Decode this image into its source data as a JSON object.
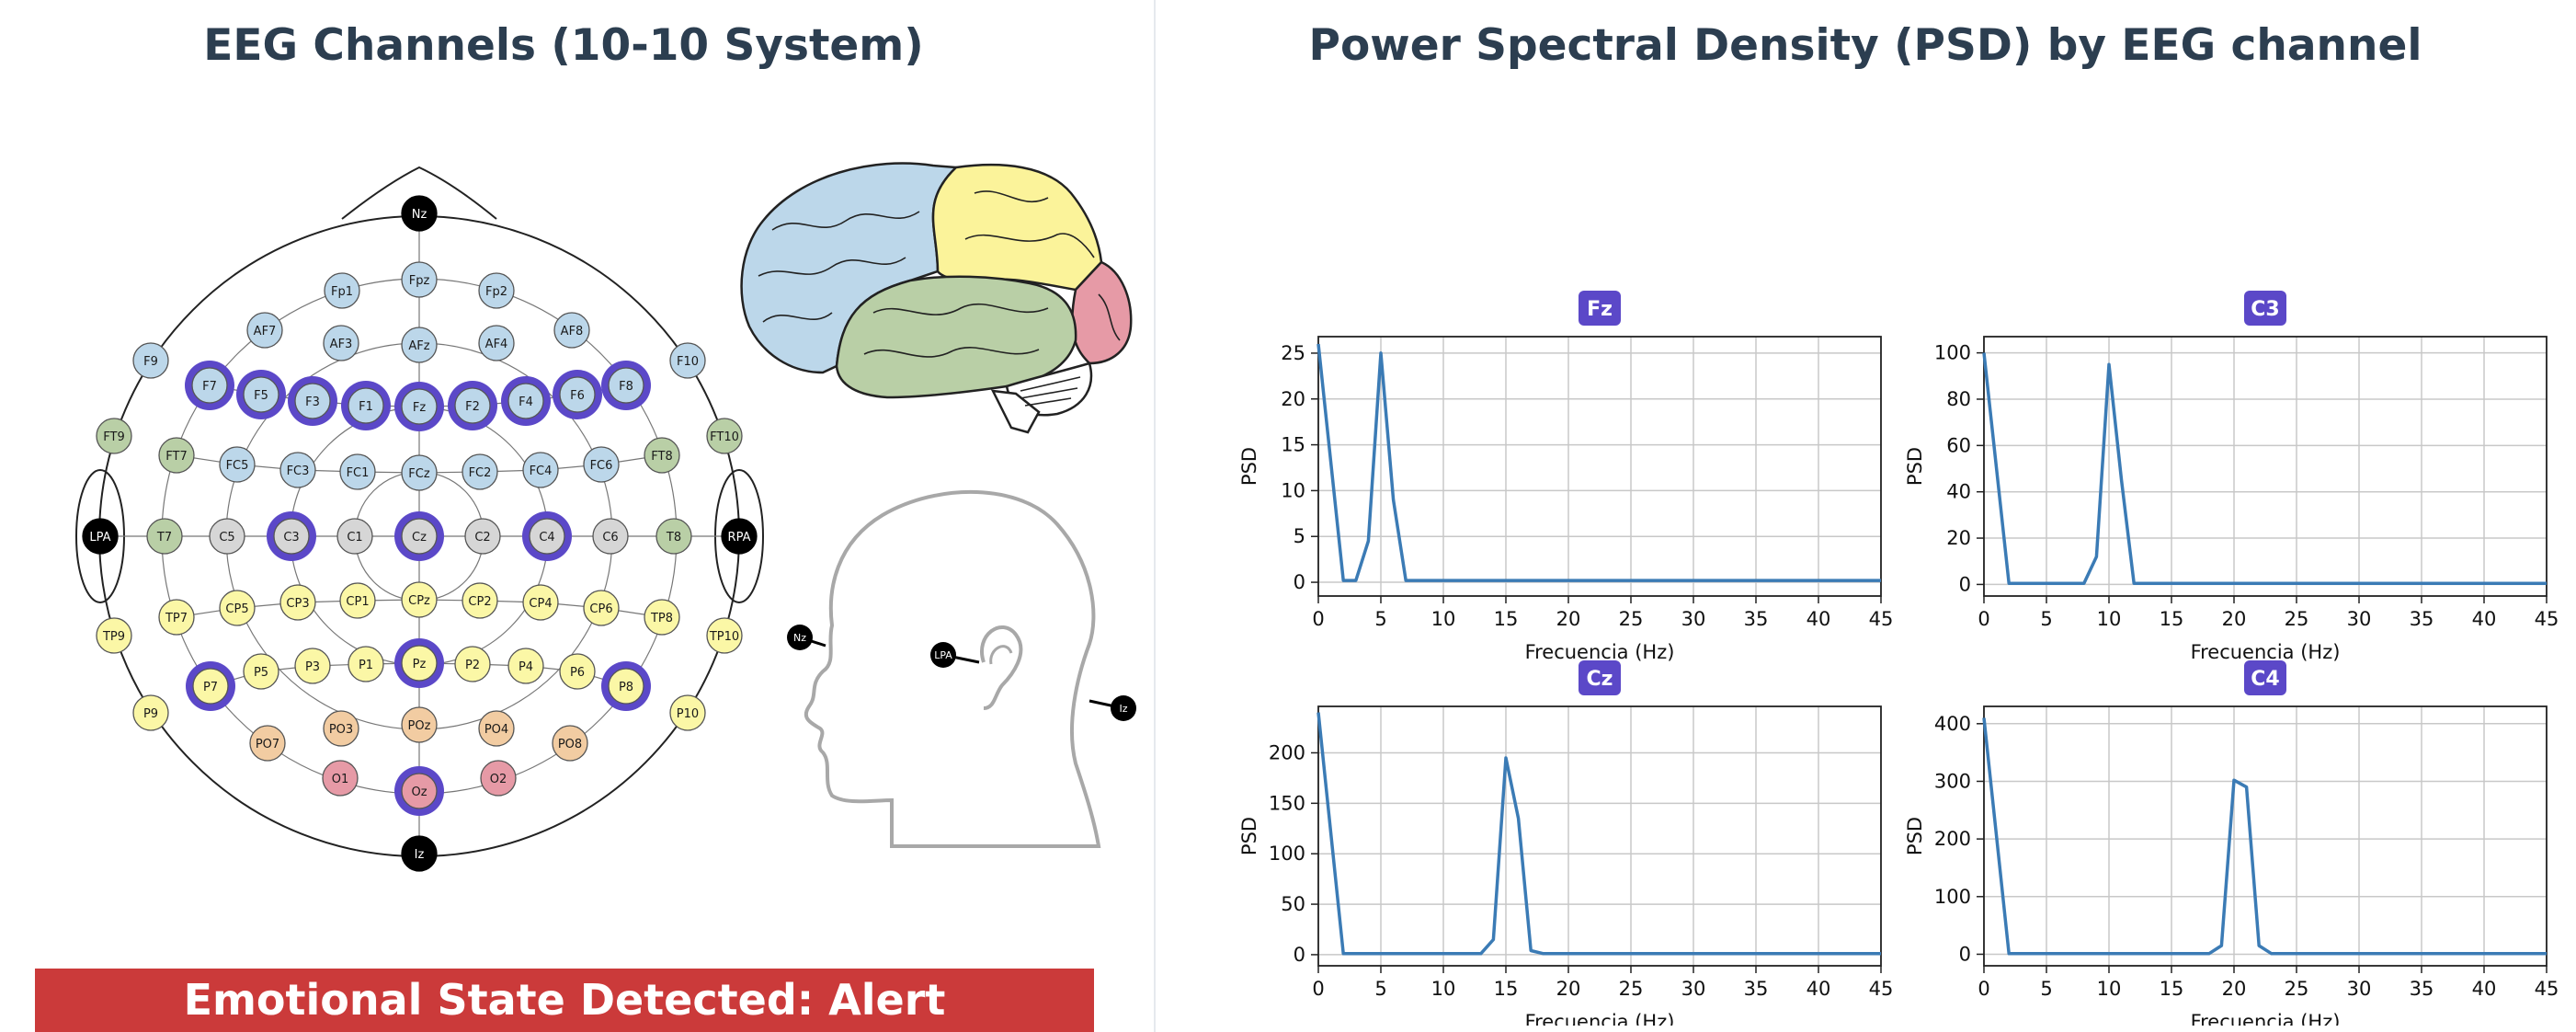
{
  "left_panel": {
    "title": "EEG Channels (10-10 System)",
    "highlight_color": "#5b48c8",
    "region_colors": {
      "frontal": "#bcd7ea",
      "central": "#d6d6d6",
      "parietal": "#fbf7a6",
      "temporal": "#b9cfa6",
      "occipital": "#e69aa6",
      "parieto-occipital": "#f2cca2",
      "fiducial": "#000000"
    },
    "electrodes": [
      {
        "label": "Nz",
        "region": "fiducial",
        "selected": false
      },
      {
        "label": "Fp1",
        "region": "frontal",
        "selected": false
      },
      {
        "label": "Fpz",
        "region": "frontal",
        "selected": false
      },
      {
        "label": "Fp2",
        "region": "frontal",
        "selected": false
      },
      {
        "label": "AF7",
        "region": "frontal",
        "selected": false
      },
      {
        "label": "AF3",
        "region": "frontal",
        "selected": false
      },
      {
        "label": "AFz",
        "region": "frontal",
        "selected": false
      },
      {
        "label": "AF4",
        "region": "frontal",
        "selected": false
      },
      {
        "label": "AF8",
        "region": "frontal",
        "selected": false
      },
      {
        "label": "F9",
        "region": "frontal",
        "selected": false
      },
      {
        "label": "F7",
        "region": "frontal",
        "selected": true
      },
      {
        "label": "F5",
        "region": "frontal",
        "selected": true
      },
      {
        "label": "F3",
        "region": "frontal",
        "selected": true
      },
      {
        "label": "F1",
        "region": "frontal",
        "selected": true
      },
      {
        "label": "Fz",
        "region": "frontal",
        "selected": true
      },
      {
        "label": "F2",
        "region": "frontal",
        "selected": true
      },
      {
        "label": "F4",
        "region": "frontal",
        "selected": true
      },
      {
        "label": "F6",
        "region": "frontal",
        "selected": true
      },
      {
        "label": "F8",
        "region": "frontal",
        "selected": true
      },
      {
        "label": "F10",
        "region": "frontal",
        "selected": false
      },
      {
        "label": "FT9",
        "region": "temporal",
        "selected": false
      },
      {
        "label": "FT7",
        "region": "temporal",
        "selected": false
      },
      {
        "label": "FC5",
        "region": "frontal",
        "selected": false
      },
      {
        "label": "FC3",
        "region": "frontal",
        "selected": false
      },
      {
        "label": "FC1",
        "region": "frontal",
        "selected": false
      },
      {
        "label": "FCz",
        "region": "frontal",
        "selected": false
      },
      {
        "label": "FC2",
        "region": "frontal",
        "selected": false
      },
      {
        "label": "FC4",
        "region": "frontal",
        "selected": false
      },
      {
        "label": "FC6",
        "region": "frontal",
        "selected": false
      },
      {
        "label": "FT8",
        "region": "temporal",
        "selected": false
      },
      {
        "label": "FT10",
        "region": "temporal",
        "selected": false
      },
      {
        "label": "LPA",
        "region": "fiducial",
        "selected": false
      },
      {
        "label": "T7",
        "region": "temporal",
        "selected": false
      },
      {
        "label": "C5",
        "region": "central",
        "selected": false
      },
      {
        "label": "C3",
        "region": "central",
        "selected": true
      },
      {
        "label": "C1",
        "region": "central",
        "selected": false
      },
      {
        "label": "Cz",
        "region": "central",
        "selected": true
      },
      {
        "label": "C2",
        "region": "central",
        "selected": false
      },
      {
        "label": "C4",
        "region": "central",
        "selected": true
      },
      {
        "label": "C6",
        "region": "central",
        "selected": false
      },
      {
        "label": "T8",
        "region": "temporal",
        "selected": false
      },
      {
        "label": "RPA",
        "region": "fiducial",
        "selected": false
      },
      {
        "label": "TP9",
        "region": "parietal",
        "selected": false
      },
      {
        "label": "TP7",
        "region": "parietal",
        "selected": false
      },
      {
        "label": "CP5",
        "region": "parietal",
        "selected": false
      },
      {
        "label": "CP3",
        "region": "parietal",
        "selected": false
      },
      {
        "label": "CP1",
        "region": "parietal",
        "selected": false
      },
      {
        "label": "CPz",
        "region": "parietal",
        "selected": false
      },
      {
        "label": "CP2",
        "region": "parietal",
        "selected": false
      },
      {
        "label": "CP4",
        "region": "parietal",
        "selected": false
      },
      {
        "label": "CP6",
        "region": "parietal",
        "selected": false
      },
      {
        "label": "TP8",
        "region": "parietal",
        "selected": false
      },
      {
        "label": "TP10",
        "region": "parietal",
        "selected": false
      },
      {
        "label": "P9",
        "region": "parietal",
        "selected": false
      },
      {
        "label": "P7",
        "region": "parietal",
        "selected": true
      },
      {
        "label": "P5",
        "region": "parietal",
        "selected": false
      },
      {
        "label": "P3",
        "region": "parietal",
        "selected": false
      },
      {
        "label": "P1",
        "region": "parietal",
        "selected": false
      },
      {
        "label": "Pz",
        "region": "parietal",
        "selected": true
      },
      {
        "label": "P2",
        "region": "parietal",
        "selected": false
      },
      {
        "label": "P4",
        "region": "parietal",
        "selected": false
      },
      {
        "label": "P6",
        "region": "parietal",
        "selected": false
      },
      {
        "label": "P8",
        "region": "parietal",
        "selected": true
      },
      {
        "label": "P10",
        "region": "parietal",
        "selected": false
      },
      {
        "label": "PO7",
        "region": "parieto-occipital",
        "selected": false
      },
      {
        "label": "PO3",
        "region": "parieto-occipital",
        "selected": false
      },
      {
        "label": "POz",
        "region": "parieto-occipital",
        "selected": false
      },
      {
        "label": "PO4",
        "region": "parieto-occipital",
        "selected": false
      },
      {
        "label": "PO8",
        "region": "parieto-occipital",
        "selected": false
      },
      {
        "label": "O1",
        "region": "occipital",
        "selected": false
      },
      {
        "label": "Oz",
        "region": "occipital",
        "selected": true
      },
      {
        "label": "O2",
        "region": "occipital",
        "selected": false
      },
      {
        "label": "Iz",
        "region": "fiducial",
        "selected": false
      }
    ],
    "side_view_labels": {
      "nasion": "Nz",
      "preauricular": "LPA",
      "inion": "Iz"
    },
    "brain_lobe_colors": [
      "#bcd7ea",
      "#fbf39a",
      "#b9cfa6",
      "#e69aa6"
    ],
    "emotion_banner": {
      "text": "Emotional State Detected: Alert",
      "color": "#cb3a3a"
    }
  },
  "right_panel": {
    "title": "Power Spectral Density (PSD) by EEG channel",
    "badge_color": "#5b48c8",
    "line_color": "#3b7bb5"
  },
  "chart_data": [
    {
      "type": "line",
      "title": "Fz",
      "xlabel": "Frecuencia (Hz)",
      "ylabel": "PSD",
      "xlim": [
        0,
        45
      ],
      "ylim": [
        -1.5,
        26.8
      ],
      "xticks": [
        0,
        5,
        10,
        15,
        20,
        25,
        30,
        35,
        40,
        45
      ],
      "yticks": [
        0,
        5,
        10,
        15,
        20,
        25
      ],
      "grid": true,
      "x": [
        0,
        2,
        3,
        4,
        5,
        6,
        7,
        45
      ],
      "y": [
        26,
        0.2,
        0.2,
        4.5,
        25,
        9,
        0.2,
        0.2
      ]
    },
    {
      "type": "line",
      "title": "C3",
      "xlabel": "Frecuencia (Hz)",
      "ylabel": "PSD",
      "xlim": [
        0,
        45
      ],
      "ylim": [
        -5,
        107
      ],
      "xticks": [
        0,
        5,
        10,
        15,
        20,
        25,
        30,
        35,
        40,
        45
      ],
      "yticks": [
        0,
        20,
        40,
        60,
        80,
        100
      ],
      "grid": true,
      "x": [
        0,
        2,
        8,
        9,
        10,
        11,
        12,
        45
      ],
      "y": [
        100,
        0.5,
        0.5,
        12,
        95,
        45,
        0.5,
        0.5
      ]
    },
    {
      "type": "line",
      "title": "Cz",
      "xlabel": "Frecuencia (Hz)",
      "ylabel": "PSD",
      "xlim": [
        0,
        45
      ],
      "ylim": [
        -11,
        246
      ],
      "xticks": [
        0,
        5,
        10,
        15,
        20,
        25,
        30,
        35,
        40,
        45
      ],
      "yticks": [
        0,
        50,
        100,
        150,
        200
      ],
      "grid": true,
      "x": [
        0,
        2,
        13,
        14,
        15,
        16,
        17,
        18,
        45
      ],
      "y": [
        240,
        1,
        1,
        15,
        195,
        135,
        4,
        1,
        1
      ]
    },
    {
      "type": "line",
      "title": "C4",
      "xlabel": "Frecuencia (Hz)",
      "ylabel": "PSD",
      "xlim": [
        0,
        45
      ],
      "ylim": [
        -20,
        430
      ],
      "xticks": [
        0,
        5,
        10,
        15,
        20,
        25,
        30,
        35,
        40,
        45
      ],
      "yticks": [
        0,
        100,
        200,
        300,
        400
      ],
      "grid": true,
      "x": [
        0,
        2,
        18,
        19,
        20,
        21,
        22,
        23,
        45
      ],
      "y": [
        410,
        1,
        1,
        15,
        302,
        290,
        15,
        1,
        1
      ]
    }
  ]
}
